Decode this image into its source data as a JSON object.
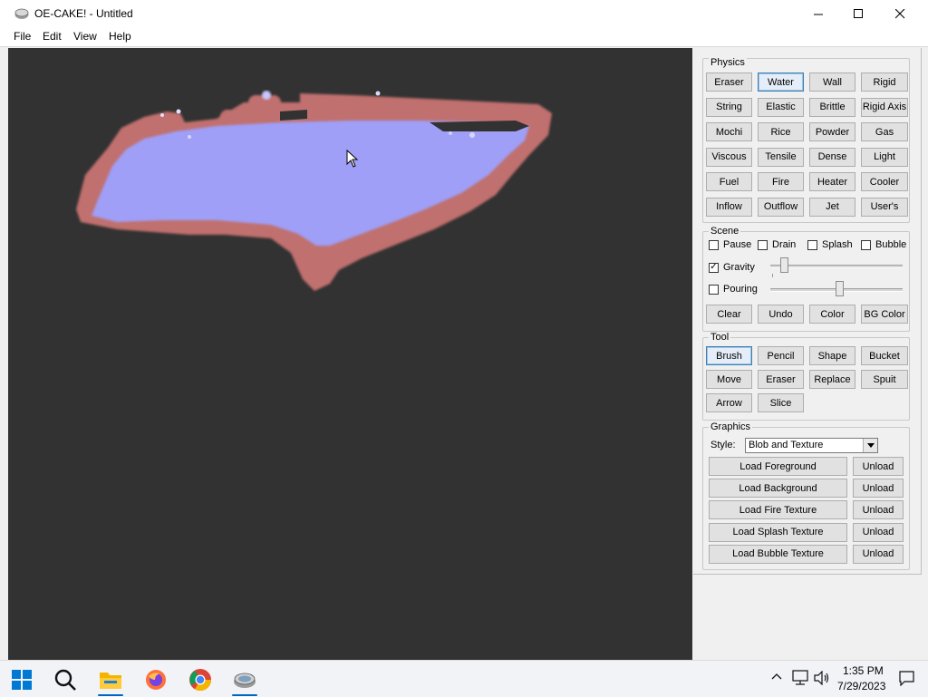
{
  "window": {
    "title": "OE-CAKE! - Untitled"
  },
  "menu": [
    "File",
    "Edit",
    "View",
    "Help"
  ],
  "physics": {
    "label": "Physics",
    "buttons": [
      "Eraser",
      "Water",
      "Wall",
      "Rigid",
      "String",
      "Elastic",
      "Brittle",
      "Rigid Axis",
      "Mochi",
      "Rice",
      "Powder",
      "Gas",
      "Viscous",
      "Tensile",
      "Dense",
      "Light",
      "Fuel",
      "Fire",
      "Heater",
      "Cooler",
      "Inflow",
      "Outflow",
      "Jet",
      "User's"
    ],
    "selected": "Water"
  },
  "scene": {
    "label": "Scene",
    "checks": [
      {
        "label": "Pause",
        "checked": false
      },
      {
        "label": "Drain",
        "checked": false
      },
      {
        "label": "Splash",
        "checked": false
      },
      {
        "label": "Bubble",
        "checked": false
      }
    ],
    "gravity": {
      "label": "Gravity",
      "checked": true,
      "level": 0.1
    },
    "pouring": {
      "label": "Pouring",
      "checked": false,
      "level": 0.52
    },
    "buttons": [
      "Clear",
      "Undo",
      "Color",
      "BG Color"
    ]
  },
  "tool": {
    "label": "Tool",
    "buttons": [
      "Brush",
      "Pencil",
      "Shape",
      "Bucket",
      "Move",
      "Eraser",
      "Replace",
      "Spuit",
      "Arrow",
      "Slice"
    ],
    "selected": "Brush"
  },
  "graphics": {
    "label": "Graphics",
    "style_label": "Style:",
    "style_value": "Blob and Texture",
    "loads": [
      {
        "load": "Load Foreground",
        "unload": "Unload"
      },
      {
        "load": "Load Background",
        "unload": "Unload"
      },
      {
        "load": "Load Fire Texture",
        "unload": "Unload"
      },
      {
        "load": "Load Splash Texture",
        "unload": "Unload"
      },
      {
        "load": "Load Bubble Texture",
        "unload": "Unload"
      }
    ]
  },
  "colors": {
    "canvas": "#323232",
    "water": "#9f9ff8",
    "wall": "#c0706e"
  },
  "taskbar": {
    "icons": [
      "windows-start-icon",
      "search-icon",
      "file-explorer-icon",
      "firefox-icon",
      "chrome-icon",
      "oe-cake-icon"
    ],
    "time": "1:35 PM",
    "date": "7/29/2023"
  }
}
